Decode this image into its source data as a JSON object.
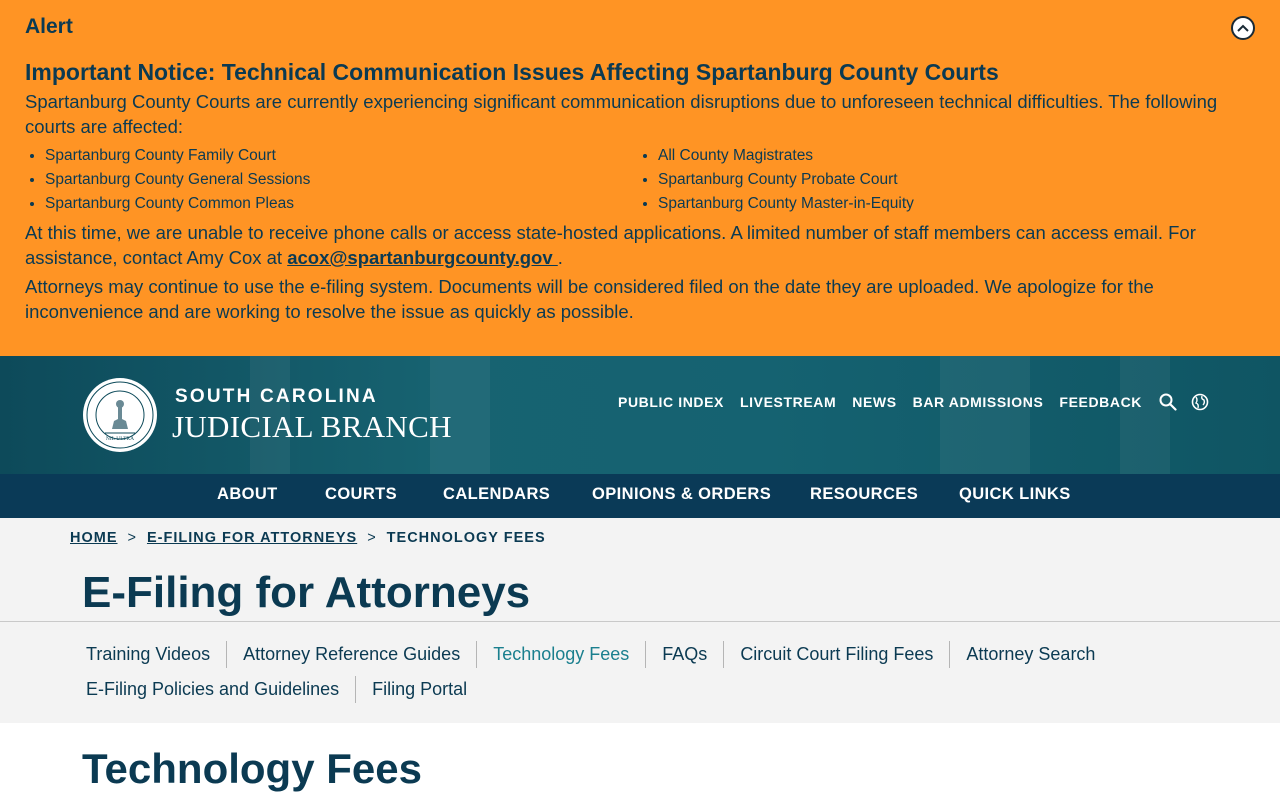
{
  "alert": {
    "label": "Alert",
    "heading": "Important Notice: Technical Communication Issues Affecting Spartanburg County Courts",
    "intro": "Spartanburg County Courts are currently experiencing significant communication disruptions due to unforeseen technical difficulties. The following courts are affected:",
    "courts_col1": [
      "Spartanburg County Family Court",
      "Spartanburg County General Sessions",
      "Spartanburg County Common Pleas"
    ],
    "courts_col2": [
      "All County Magistrates",
      "Spartanburg County Probate Court",
      "Spartanburg County Master-in-Equity"
    ],
    "contact_text": "At this time, we are unable to receive phone calls or access state-hosted applications. A limited number of staff members can access email. For assistance, contact Amy Cox at ",
    "contact_email": "acox@spartanburgcounty.gov ",
    "contact_end": ".",
    "filing_text": "Attorneys may continue to use the e-filing system. Documents will be considered filed on the date they are uploaded. We apologize for the inconvenience and are working to resolve the issue as quickly as possible."
  },
  "header": {
    "brand_top": "SOUTH CAROLINA",
    "brand_bottom": "JUDICIAL BRANCH",
    "seal_text": "NIL ULTRA",
    "utility_links": [
      "PUBLIC INDEX",
      "LIVESTREAM",
      "NEWS",
      "BAR ADMISSIONS",
      "FEEDBACK"
    ]
  },
  "main_nav": [
    "ABOUT",
    "COURTS",
    "CALENDARS",
    "OPINIONS & ORDERS",
    "RESOURCES",
    "QUICK LINKS"
  ],
  "breadcrumb": {
    "home": "HOME",
    "sep": ">",
    "parent": "E-FILING FOR ATTORNEYS",
    "current": "TECHNOLOGY FEES"
  },
  "page_title": "E-Filing for Attorneys",
  "subnav": {
    "row1": [
      "Training Videos",
      "Attorney Reference Guides",
      "Technology Fees",
      "FAQs",
      "Circuit Court Filing Fees",
      "Attorney Search"
    ],
    "row2": [
      "E-Filing Policies and Guidelines",
      "Filing Portal"
    ],
    "active": "Technology Fees"
  },
  "section_title": "Technology Fees",
  "colors": {
    "alert_bg": "#ff9424",
    "navy": "#0a3a57",
    "teal_header": "#176371",
    "active_link": "#1a7f8e"
  },
  "icons": {
    "collapse": "chevron-up-icon",
    "search": "search-icon",
    "language": "globe-icon",
    "seal": "court-seal-logo"
  }
}
